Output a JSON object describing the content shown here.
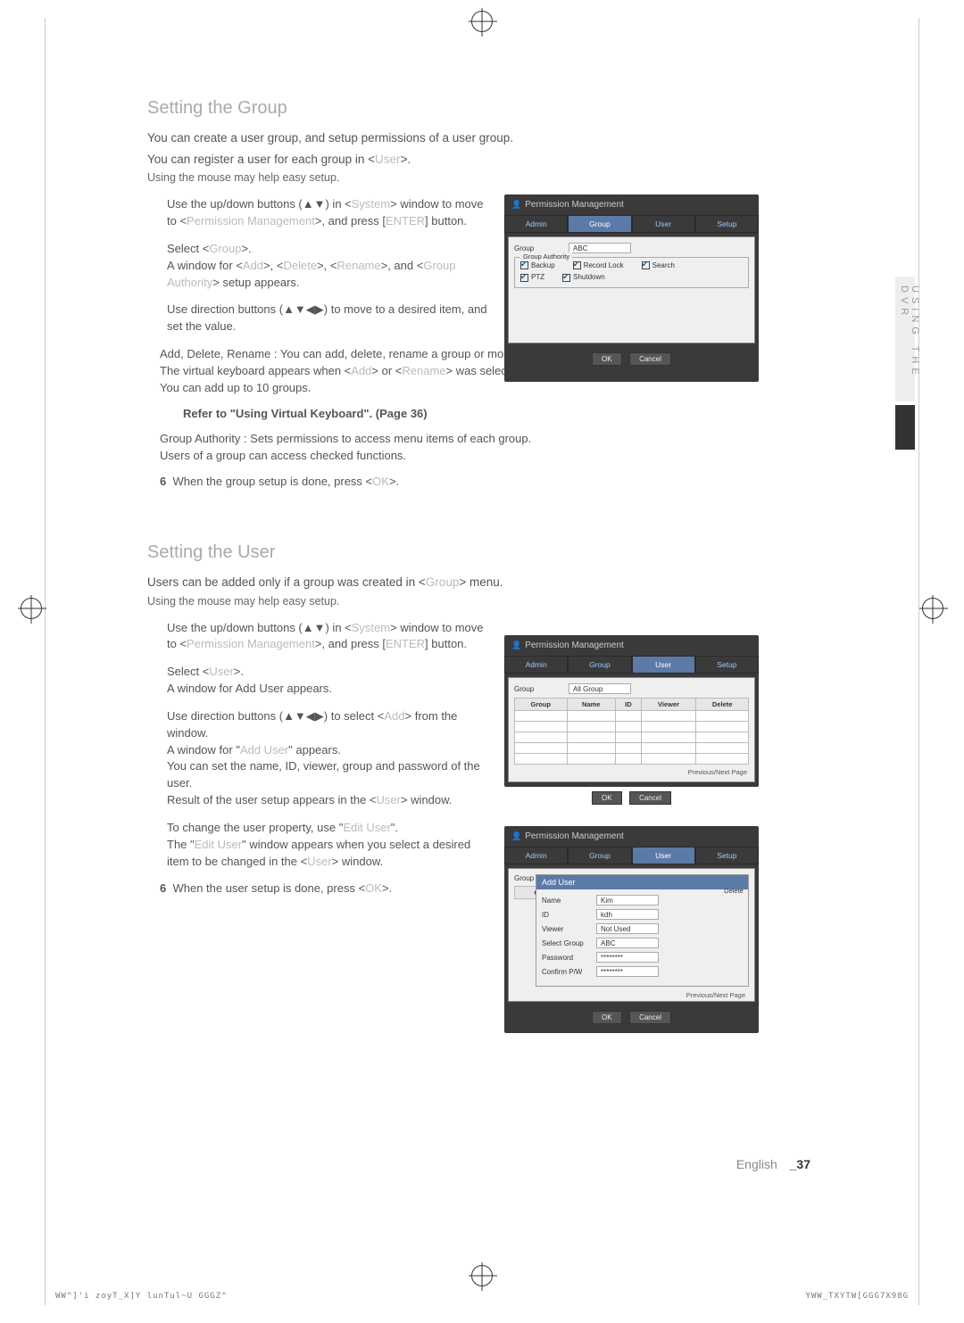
{
  "sideTab": "USING THE DVR",
  "section1": {
    "title": "Setting the Group",
    "intro1": "You can create a user group, and setup permissions of a user group.",
    "intro2": "You can register a user for each group in <",
    "intro2b": "User",
    "intro2c": ">.",
    "sub": "Using the mouse may help easy setup.",
    "s1a": "Use the up/down buttons (▲▼) in <",
    "s1a2": "System",
    "s1a3": "> window to move to <",
    "s1a4": "Permission Management",
    "s1a5": ">, and press [",
    "s1a6": "ENTER",
    "s1a7": "] button.",
    "s2a": "Select <",
    "s2b": "Group",
    "s2c": ">.",
    "s2d": "A window for <",
    "s2e": "Add",
    "s2f": ">, <",
    "s2g": "Delete",
    "s2h": ">, <",
    "s2i": "Rename",
    "s2j": ">, and <",
    "s2k": "Group Authority",
    "s2l": "> setup appears.",
    "s3a": "Use direction buttons (▲▼◀▶) to move to a desired item, and set the value.",
    "b1": "Add, Delete, Rename : You can add, delete, rename a group or modify the permissions given to the group.",
    "b1b": "The virtual keyboard appears when <",
    "b1c": "Add",
    "b1d": "> or <",
    "b1e": "Rename",
    "b1f": "> was selected.",
    "b1g": "You can add up to 10 groups.",
    "ref1": "Refer to \"",
    "ref2": "Using Virtual Keyboard",
    "ref3": "\". (Page 36)",
    "b2": "Group Authority : Sets permissions to access menu items of each group.",
    "b2b": "Users of a group can access checked functions.",
    "s6": "When the group setup is done, press <",
    "s6b": "OK",
    "s6c": ">."
  },
  "section2": {
    "title": "Setting the User",
    "intro": "Users can be added only if a group was created in <",
    "introb": "Group",
    "introc": "> menu.",
    "sub": "Using the mouse may help easy setup.",
    "s1a": "Use the up/down buttons (▲▼) in <",
    "s1b": "System",
    "s1c": "> window to move to <",
    "s1d": "Permission Management",
    "s1e": ">, and press [",
    "s1f": "ENTER",
    "s1g": "] button.",
    "s2a": "Select <",
    "s2b": "User",
    "s2c": ">.",
    "s2d": "A window for Add User appears.",
    "s3a": "Use direction buttons (▲▼◀▶) to select <",
    "s3b": "Add",
    "s3c": "> from the window.",
    "s3d": "A window for \"",
    "s3e": "Add User",
    "s3f": "\" appears.",
    "s3g": "You can set the name, ID, viewer, group and password of the user.",
    "s3h": "Result of the user setup appears in the <",
    "s3i": "User",
    "s3j": "> window.",
    "s4a": "To change the user property, use \"",
    "s4b": "Edit User",
    "s4c": "\".",
    "s4d": "The \"",
    "s4e": "Edit User",
    "s4f": "\" window appears when you select a desired item to be changed in the <",
    "s4g": "User",
    "s4h": "> window.",
    "s6": "When the user setup is done, press <",
    "s6b": "OK",
    "s6c": ">."
  },
  "dvr": {
    "title": "Permission Management",
    "tabs": {
      "admin": "Admin",
      "group": "Group",
      "user": "User",
      "setup": "Setup"
    },
    "unit1": {
      "groupLbl": "Group",
      "groupVal": "ABC",
      "fsTitle": "Group Authority",
      "c1": "Backup",
      "c2": "Record Lock",
      "c3": "Search",
      "c4": "PTZ",
      "c5": "Shutdown"
    },
    "unit2": {
      "groupLbl": "Group",
      "groupVal": "All Group",
      "th": {
        "a": "Group",
        "b": "Name",
        "c": "ID",
        "d": "Viewer",
        "e": "Delete"
      },
      "prev": "Previous/Next Page"
    },
    "unit3": {
      "head": "Add User",
      "f": {
        "name": "Name",
        "nameV": "Kim",
        "id": "ID",
        "idV": "kdh",
        "viewer": "Viewer",
        "viewerV": "Not Used",
        "grp": "Select Group",
        "grpV": "ABC",
        "pwd": "Password",
        "pwdV": "********",
        "conf": "Confirm P/W",
        "confV": "********"
      },
      "prev": "Previous/Next Page"
    },
    "ok": "OK",
    "cancel": "Cancel"
  },
  "footer": {
    "lang": "English",
    "page": "_37",
    "bl": "WW^]'i zoyT_X]Y lunTul~U    GGGZ^",
    "br": "YWW_TXYTW[GGG7X98G"
  }
}
